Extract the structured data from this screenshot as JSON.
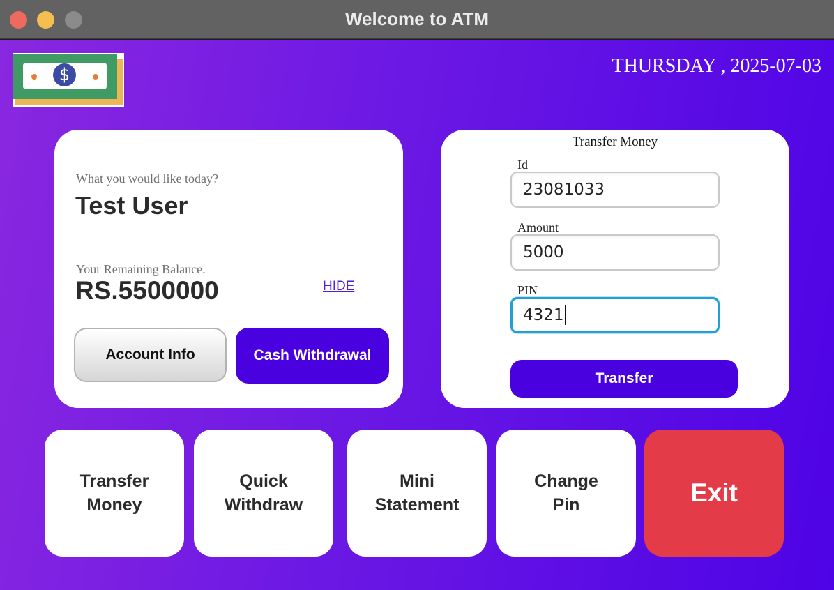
{
  "window": {
    "title": "Welcome to ATM"
  },
  "header": {
    "date": "THURSDAY , 2025-07-03"
  },
  "account_card": {
    "greeting": "What you would like today?",
    "user_name": "Test User",
    "balance_label": "Your Remaining Balance.",
    "balance_value": "RS.5500000",
    "hide_label": "HIDE",
    "account_info_label": "Account Info",
    "cash_withdrawal_label": "Cash Withdrawal"
  },
  "transfer_card": {
    "title": "Transfer Money",
    "id_label": "Id",
    "id_value": "23081033",
    "amount_label": "Amount",
    "amount_value": "5000",
    "pin_label": "PIN",
    "pin_value": "4321",
    "transfer_label": "Transfer"
  },
  "menu": {
    "transfer_money": [
      "Transfer",
      "Money"
    ],
    "quick_withdraw": [
      "Quick",
      "Withdraw"
    ],
    "mini_statement": [
      "Mini",
      "Statement"
    ],
    "change_pin": [
      "Change",
      "Pin"
    ],
    "exit": "Exit"
  },
  "colors": {
    "primary_button": "#4a01df",
    "exit_button": "#e33b47",
    "focus_ring": "#21a0d8",
    "logo_bill": "#3f9a63",
    "logo_coin": "#3b4ba3"
  },
  "icons": {
    "logo": "dollar-bill-icon"
  }
}
